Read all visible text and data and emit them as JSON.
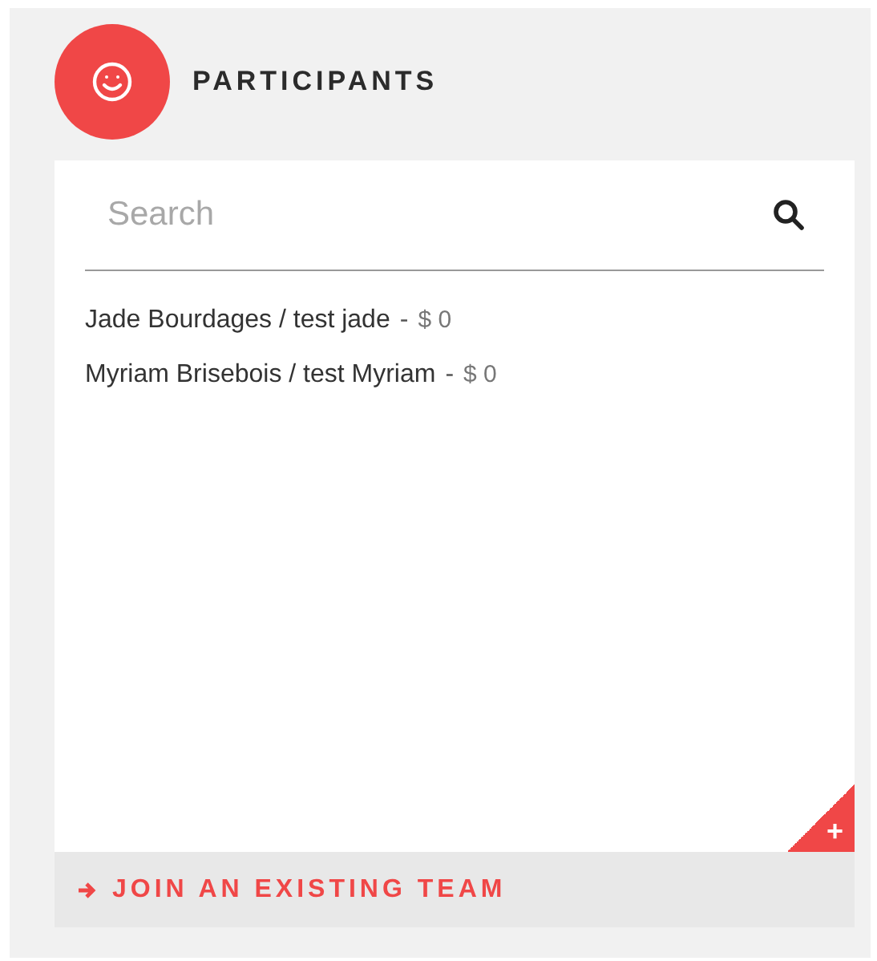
{
  "header": {
    "title": "PARTICIPANTS"
  },
  "search": {
    "placeholder": "Search"
  },
  "participants": [
    {
      "name": "Jade Bourdages / test jade",
      "separator": "-",
      "amount": "$ 0"
    },
    {
      "name": "Myriam Brisebois / test Myriam",
      "separator": "-",
      "amount": "$ 0"
    }
  ],
  "add_corner": {
    "label": "+"
  },
  "footer": {
    "link": "JOIN AN EXISTING TEAM"
  }
}
